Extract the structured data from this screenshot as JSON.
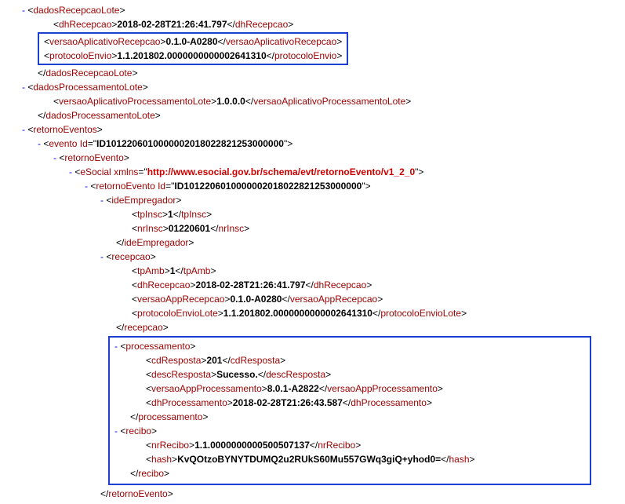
{
  "tags": {
    "dadosRecepcaoLote": "dadosRecepcaoLote",
    "dhRecepcao": "dhRecepcao",
    "versaoAplicativoRecepcao": "versaoAplicativoRecepcao",
    "protocoloEnvio": "protocoloEnvio",
    "dadosProcessamentoLote": "dadosProcessamentoLote",
    "versaoAplicativoProcessamentoLote": "versaoAplicativoProcessamentoLote",
    "retornoEventos": "retornoEventos",
    "evento": "evento",
    "retornoEvento": "retornoEvento",
    "eSocial": "eSocial",
    "ideEmpregador": "ideEmpregador",
    "tpInsc": "tpInsc",
    "nrInsc": "nrInsc",
    "recepcao": "recepcao",
    "tpAmb": "tpAmb",
    "versaoAppRecepcao": "versaoAppRecepcao",
    "protocoloEnvioLote": "protocoloEnvioLote",
    "processamento": "processamento",
    "cdResposta": "cdResposta",
    "descResposta": "descResposta",
    "versaoAppProcessamento": "versaoAppProcessamento",
    "dhProcessamento": "dhProcessamento",
    "recibo": "recibo",
    "nrRecibo": "nrRecibo",
    "hash": "hash"
  },
  "attrs": {
    "Id": "Id",
    "xmlns": "xmlns"
  },
  "values": {
    "dhRecepcao": "2018-02-28T21:26:41.797",
    "versaoAplicativoRecepcao": "0.1.0-A0280",
    "protocoloEnvio": "1.1.201802.0000000000002641310",
    "versaoAplicativoProcessamentoLote": "1.0.0.0",
    "eventoId": "ID1012206010000002018022821253000000",
    "eSocialXmlns": "http://www.esocial.gov.br/schema/evt/retornoEvento/v1_2_0",
    "retornoEventoId": "ID1012206010000002018022821253000000",
    "tpInsc": "1",
    "nrInsc": "01220601",
    "tpAmb": "1",
    "dhRecepcao2": "2018-02-28T21:26:41.797",
    "versaoAppRecepcao": "0.1.0-A0280",
    "protocoloEnvioLote": "1.1.201802.0000000000002641310",
    "cdResposta": "201",
    "descResposta": "Sucesso.",
    "versaoAppProcessamento": "8.0.1-A2822",
    "dhProcessamento": "2018-02-28T21:26:43.587",
    "nrRecibo": "1.1.0000000000500507137",
    "hash": "KvQOtzoBYNYTDUMQ2u2RUkS60Mu557GWq3giQ+yhod0="
  }
}
